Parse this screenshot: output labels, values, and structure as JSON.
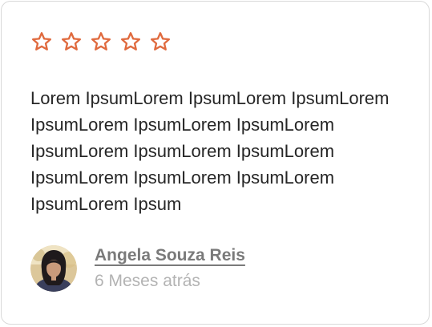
{
  "colors": {
    "star_outline": "#e06a3e",
    "text": "#262626",
    "author_name": "#7a7a7a",
    "time": "#b3b3b3",
    "border": "#d9d9d9"
  },
  "rating": {
    "filled": 0,
    "total": 5,
    "icon": "star-outline-icon"
  },
  "review": {
    "text": "Lorem IpsumLorem IpsumLorem IpsumLorem IpsumLorem IpsumLorem IpsumLorem IpsumLorem IpsumLorem IpsumLorem IpsumLorem IpsumLorem IpsumLorem IpsumLorem Ipsum"
  },
  "author": {
    "avatar_icon": "user-avatar",
    "name": "Angela Souza Reis",
    "time": "6 Meses atrás"
  }
}
